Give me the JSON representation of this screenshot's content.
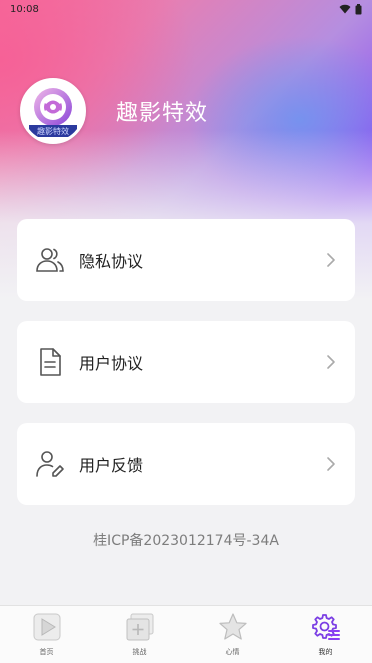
{
  "status_bar": {
    "time": "10:08"
  },
  "profile": {
    "app_name": "趣影特效",
    "avatar_text": "趣影特效"
  },
  "menu": [
    {
      "label": "隐私协议",
      "icon": "users-icon"
    },
    {
      "label": "用户协议",
      "icon": "document-icon"
    },
    {
      "label": "用户反馈",
      "icon": "user-edit-icon"
    }
  ],
  "icp": "桂ICP备2023012174号-34A",
  "tabs": [
    {
      "label": "首页",
      "icon": "play-icon",
      "active": false
    },
    {
      "label": "挑战",
      "icon": "add-icon",
      "active": false
    },
    {
      "label": "心情",
      "icon": "star-icon",
      "active": false
    },
    {
      "label": "我的",
      "icon": "gear-icon",
      "active": true
    }
  ],
  "colors": {
    "accent": "#8b3ff4",
    "gradient_start": "#f76b9a",
    "gradient_end": "#8b3ff4"
  }
}
